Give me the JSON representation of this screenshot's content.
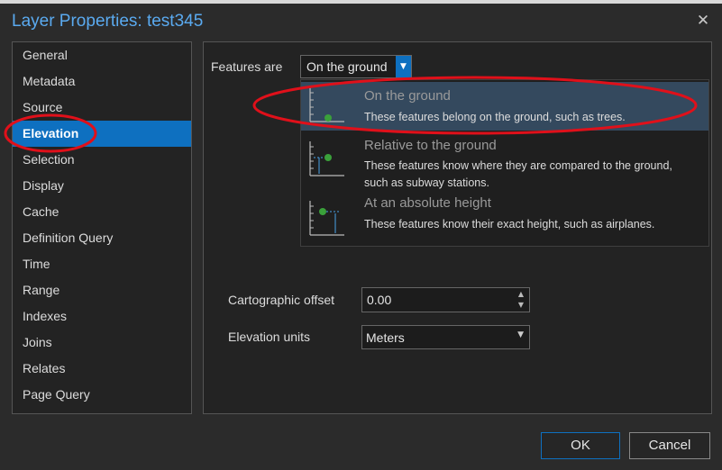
{
  "window": {
    "title": "Layer Properties: test345",
    "close_glyph": "✕"
  },
  "sidebar": {
    "items": [
      {
        "label": "General"
      },
      {
        "label": "Metadata"
      },
      {
        "label": "Source"
      },
      {
        "label": "Elevation",
        "active": true
      },
      {
        "label": "Selection"
      },
      {
        "label": "Display"
      },
      {
        "label": "Cache"
      },
      {
        "label": "Definition Query"
      },
      {
        "label": "Time"
      },
      {
        "label": "Range"
      },
      {
        "label": "Indexes"
      },
      {
        "label": "Joins"
      },
      {
        "label": "Relates"
      },
      {
        "label": "Page Query"
      }
    ]
  },
  "elevation": {
    "features_label": "Features are",
    "features_value": "On the ground",
    "options": [
      {
        "title": "On the ground",
        "desc": "These features belong on the ground, such as trees.",
        "icon": "ground-elevation-icon",
        "selected": true
      },
      {
        "title": "Relative to the ground",
        "desc": "These features know where they are compared to the ground, such as subway stations.",
        "icon": "relative-elevation-icon"
      },
      {
        "title": "At an absolute height",
        "desc": "These features know their exact height, such as airplanes.",
        "icon": "absolute-elevation-icon"
      }
    ],
    "cartographic_offset_label": "Cartographic offset",
    "cartographic_offset_value": "0.00",
    "units_label": "Elevation units",
    "units_value": "Meters"
  },
  "buttons": {
    "ok": "OK",
    "cancel": "Cancel"
  },
  "colors": {
    "accent": "#0e70c0",
    "title": "#5aaaf0",
    "annotation": "#e0101a"
  }
}
